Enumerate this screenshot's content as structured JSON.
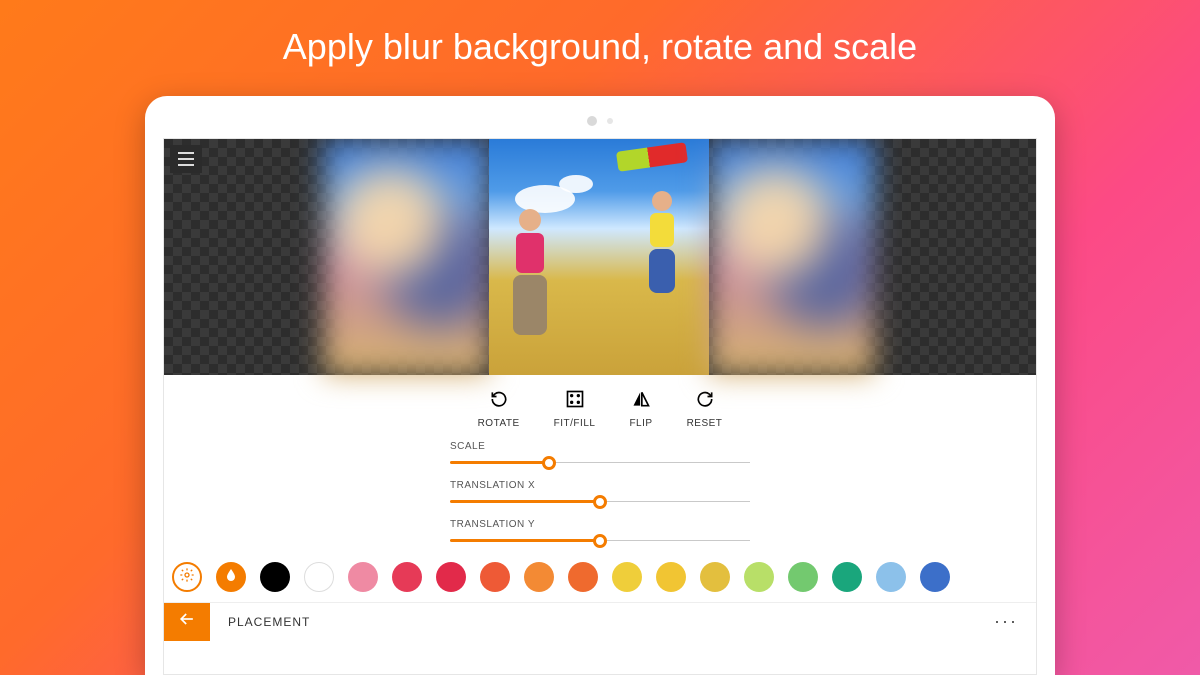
{
  "hero": {
    "title": "Apply blur background, rotate and scale"
  },
  "tools": {
    "rotate": "ROTATE",
    "fitfill": "FIT/FILL",
    "flip": "FLIP",
    "reset": "RESET"
  },
  "sliders": {
    "scale": {
      "label": "SCALE",
      "percent": 33
    },
    "translationX": {
      "label": "TRANSLATION X",
      "percent": 50
    },
    "translationY": {
      "label": "TRANSLATION Y",
      "percent": 50
    }
  },
  "swatches": [
    "#000000",
    "#ffffff",
    "#ef8aa3",
    "#e63a57",
    "#e22a4a",
    "#ee5a36",
    "#f38a34",
    "#ef6a2e",
    "#efce3a",
    "#f1c533",
    "#e3bf3e",
    "#b8df68",
    "#73c96f",
    "#1aa67c",
    "#8cc1ea",
    "#3c6fc9"
  ],
  "accent": "#f47c00",
  "bottom": {
    "section": "PLACEMENT",
    "more": "···"
  }
}
